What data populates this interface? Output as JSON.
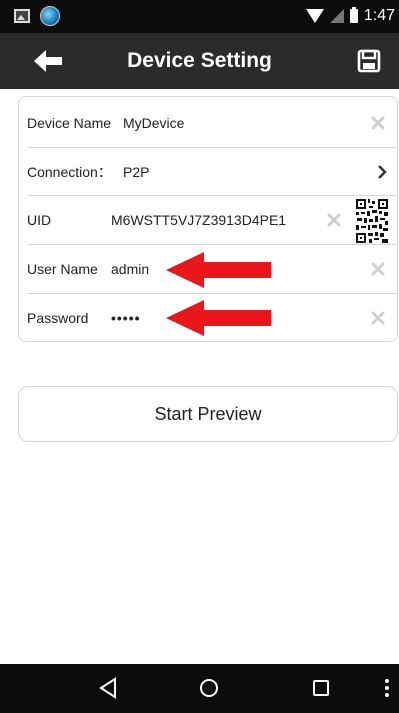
{
  "status_bar": {
    "time": "1:47",
    "icons": [
      "image-notification-icon",
      "app-notification-icon",
      "wifi-icon",
      "cell-signal-icon",
      "battery-icon"
    ]
  },
  "app_bar": {
    "title": "Device Setting",
    "back_icon": "arrow-left-icon",
    "save_icon": "floppy-disk-icon"
  },
  "form": {
    "rows": [
      {
        "label": "Device Name",
        "value": "MyDevice",
        "action": "clear-icon"
      },
      {
        "label": "Connection：",
        "value": "P2P",
        "action": "chevron-right-icon"
      },
      {
        "label": "UID",
        "value": "M6WSTT5VJ7Z3913D4PE1",
        "action": "clear-icon",
        "extra": "qr-code-icon"
      },
      {
        "label": "User Name",
        "value": "admin",
        "action": "clear-icon"
      },
      {
        "label": "Password",
        "value": "•••••",
        "action": "clear-icon"
      }
    ]
  },
  "annotations": {
    "arrow_color": "#e8171b",
    "arrows_point_to": [
      "User Name",
      "Password"
    ]
  },
  "start_button": {
    "label": "Start Preview"
  },
  "nav_bar": {
    "icons": [
      "back-triangle-icon",
      "home-circle-icon",
      "recents-square-icon",
      "more-vert-icon"
    ]
  },
  "colors": {
    "status_bar_bg": "#0c0c0c",
    "app_bar_bg": "#2b2b2b",
    "border": "#d6d6d6"
  }
}
